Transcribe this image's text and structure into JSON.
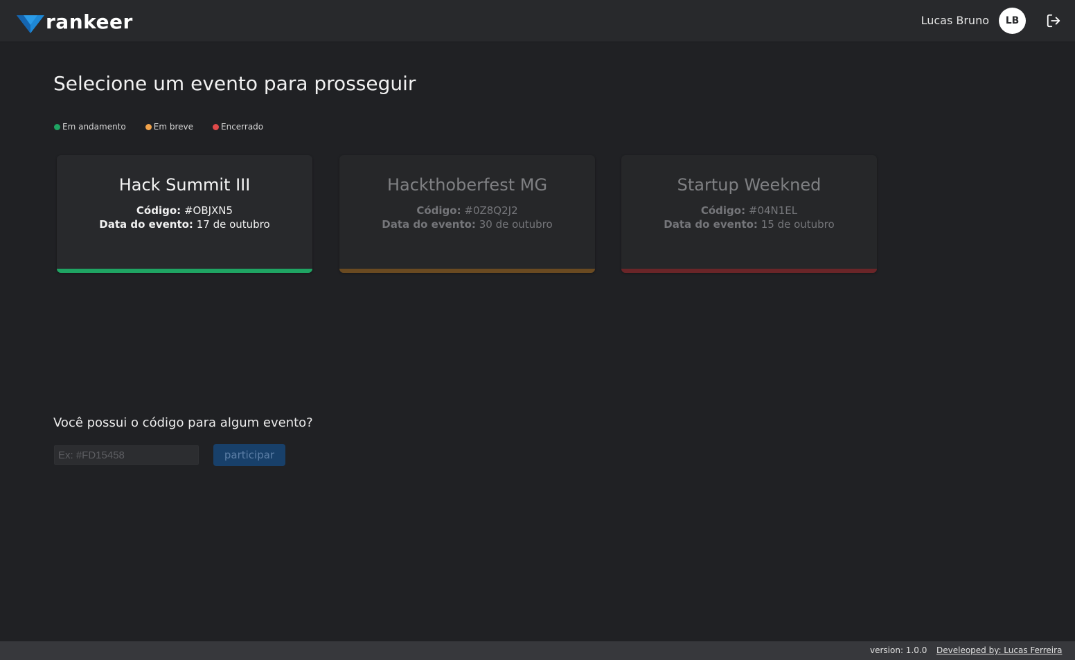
{
  "header": {
    "brand": "rankeer",
    "user_name": "Lucas Bruno",
    "avatar_initials": "LB",
    "logout_icon": "logout-icon"
  },
  "main": {
    "title": "Selecione um evento para prosseguir",
    "legend": [
      {
        "label": "Em andamento",
        "color": "#1fa463"
      },
      {
        "label": "Em breve",
        "color": "#f0a24a"
      },
      {
        "label": "Encerrado",
        "color": "#e04a4a"
      }
    ],
    "events": [
      {
        "name": "Hack Summit III",
        "code_label": "Código:",
        "code": "#OBJXN5",
        "date_label": "Data do evento:",
        "date": "17 de outubro",
        "status": "Em andamento",
        "bar_color": "#1fa463"
      },
      {
        "name": "Hackthoberfest MG",
        "code_label": "Código:",
        "code": "#0Z8Q2J2",
        "date_label": "Data do evento:",
        "date": "30 de outubro",
        "status": "Em breve",
        "bar_color": "#6a4a21"
      },
      {
        "name": "Startup Weekned",
        "code_label": "Código:",
        "code": "#04N1EL",
        "date_label": "Data do evento:",
        "date": "15 de outubro",
        "status": "Encerrado",
        "bar_color": "#6a2528"
      }
    ],
    "code_section": {
      "question": "Você possui o código para algum evento?",
      "input_placeholder": "Ex: #FD15458",
      "input_value": "",
      "button_label": "participar"
    }
  },
  "footer": {
    "version": "version: 1.0.0",
    "developer": "Develeoped by: Lucas Ferreira"
  }
}
